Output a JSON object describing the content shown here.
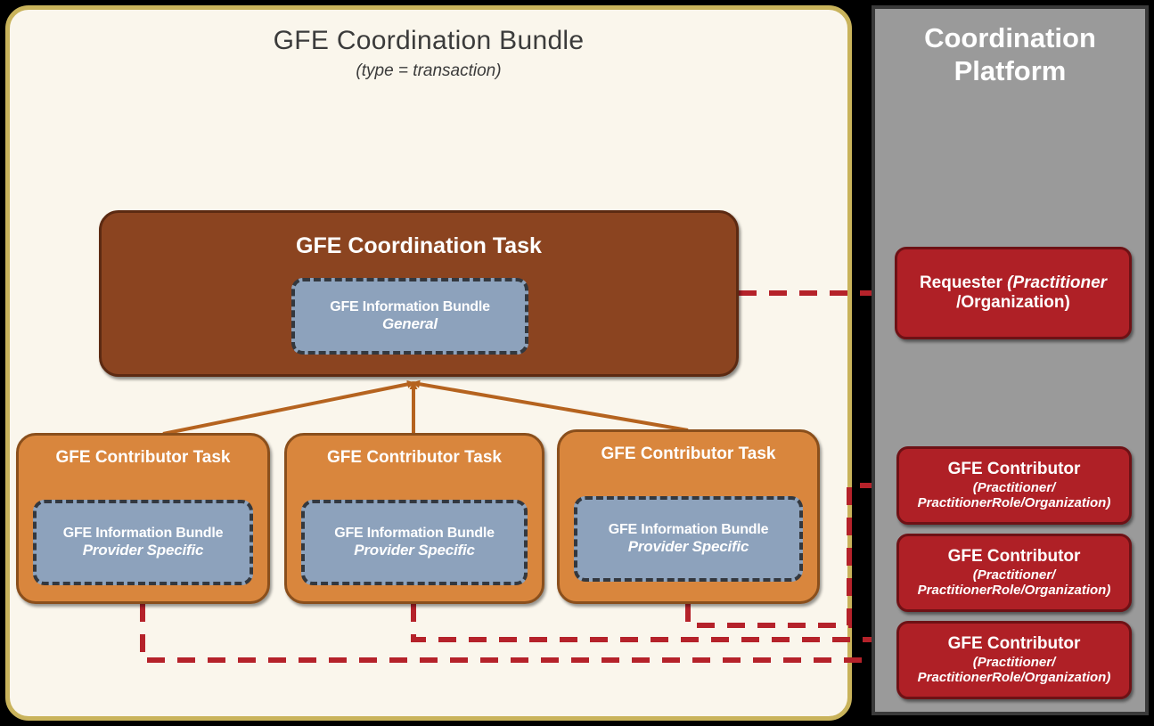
{
  "bundle": {
    "title": "GFE Coordination Bundle",
    "subtitle": "(type = transaction)",
    "coordination_task": {
      "title": "GFE Coordination Task",
      "info_bundle": {
        "line1": "GFE Information Bundle",
        "line2": "General"
      }
    },
    "contributor_tasks": [
      {
        "title": "GFE Contributor  Task",
        "info_bundle": {
          "line1": "GFE Information Bundle",
          "line2": "Provider Specific"
        }
      },
      {
        "title": "GFE Contributor  Task",
        "info_bundle": {
          "line1": "GFE Information Bundle",
          "line2": "Provider Specific"
        }
      },
      {
        "title": "GFE Contributor  Task",
        "info_bundle": {
          "line1": "GFE Information Bundle",
          "line2": "Provider Specific"
        }
      }
    ]
  },
  "platform": {
    "title": "Coordination Platform",
    "actors": [
      {
        "name": "Requester",
        "qualifier_line1": "(Practitioner",
        "qualifier_line2": "/Organization)"
      },
      {
        "name": "GFE Contributor",
        "qualifier_line1": "(Practitioner/",
        "qualifier_line2": "PractitionerRole/Organization)"
      },
      {
        "name": "GFE Contributor",
        "qualifier_line1": "(Practitioner/",
        "qualifier_line2": "PractitionerRole/Organization)"
      },
      {
        "name": "GFE Contributor",
        "qualifier_line1": "(Practitioner/",
        "qualifier_line2": "PractitionerRole/Organization)"
      }
    ]
  },
  "colors": {
    "bundle_background": "#faf6ec",
    "bundle_border": "#c9b35b",
    "coordination_task": "#8b4420",
    "contributor_task": "#d9863d",
    "information_bundle": "#8da2bc",
    "platform_panel": "#9a9a9a",
    "actor_box": "#af2026",
    "dashed_connector": "#b5222a",
    "solid_connector": "#b5631f",
    "page_background": "#000000"
  }
}
